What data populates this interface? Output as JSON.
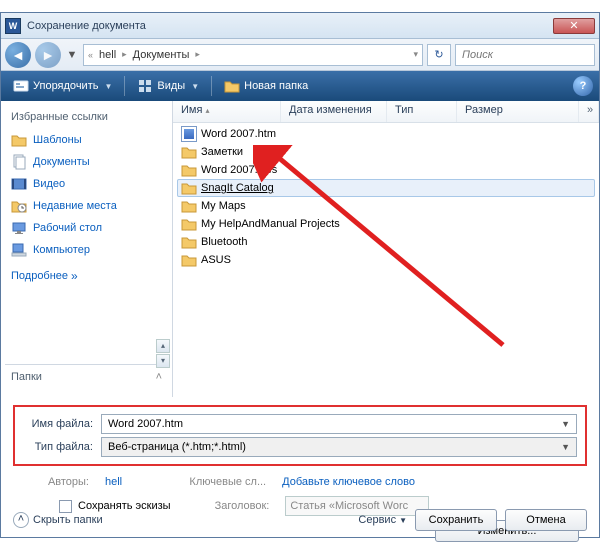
{
  "titlebar": {
    "title": "Сохранение документа"
  },
  "breadcrumb": {
    "seg1": "hell",
    "seg2": "Документы"
  },
  "search": {
    "placeholder": "Поиск"
  },
  "toolbar": {
    "organize": "Упорядочить",
    "views": "Виды",
    "newfolder": "Новая папка"
  },
  "sidebar": {
    "heading": "Избранные ссылки",
    "items": [
      {
        "label": "Шаблоны"
      },
      {
        "label": "Документы"
      },
      {
        "label": "Видео"
      },
      {
        "label": "Недавние места"
      },
      {
        "label": "Рабочий стол"
      },
      {
        "label": "Компьютер"
      }
    ],
    "more": "Подробнее",
    "folders": "Папки"
  },
  "columns": {
    "name": "Имя",
    "date": "Дата изменения",
    "type": "Тип",
    "size": "Размер"
  },
  "files": [
    {
      "name": "ASUS",
      "type": "folder"
    },
    {
      "name": "Bluetooth",
      "type": "folder"
    },
    {
      "name": "My HelpAndManual Projects",
      "type": "folder"
    },
    {
      "name": "My Maps",
      "type": "folder"
    },
    {
      "name": "SnagIt Catalog",
      "type": "folder",
      "selected": true,
      "underline": true
    },
    {
      "name": "Word 2007.files",
      "type": "folder"
    },
    {
      "name": "Заметки",
      "type": "folder"
    },
    {
      "name": "Word 2007.htm",
      "type": "htm"
    }
  ],
  "form": {
    "filename_label": "Имя файла:",
    "filename_value": "Word 2007.htm",
    "filetype_label": "Тип файла:",
    "filetype_value": "Веб-страница (*.htm;*.html)"
  },
  "meta": {
    "authors_label": "Авторы:",
    "authors_value": "hell",
    "keywords_label": "Ключевые сл...",
    "keywords_value": "Добавьте ключевое слово",
    "save_thumb": "Сохранять эскизы",
    "title_label": "Заголовок:",
    "title_value": "Статья «Microsoft Worc",
    "change": "Изменить..."
  },
  "footer": {
    "hide": "Скрыть папки",
    "service": "Сервис",
    "save": "Сохранить",
    "cancel": "Отмена"
  }
}
